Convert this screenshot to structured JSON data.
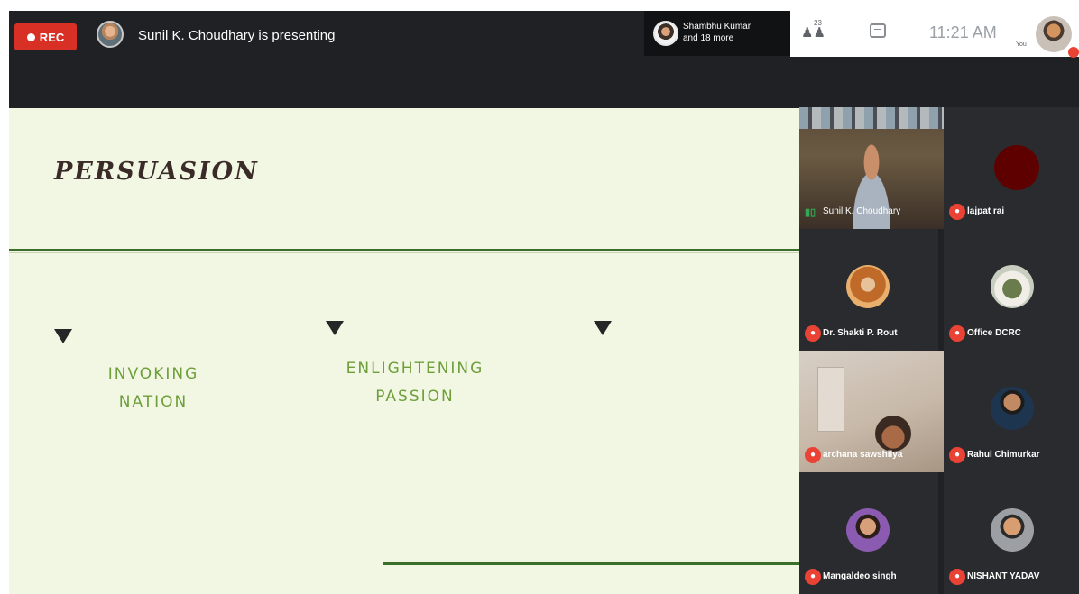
{
  "topbar": {
    "rec_label": "REC",
    "presenting_text": "Sunil K. Choudhary is presenting",
    "others": {
      "line1": "Shambhu Kumar",
      "line2": "and 18 more"
    },
    "people_count": "23",
    "clock": "11:21 AM",
    "you_label": "You"
  },
  "slide": {
    "title": "PERSUASION",
    "bullets": [
      {
        "line1": "INVOKING",
        "line2": "NATION"
      },
      {
        "line1": "ENLIGHTENING",
        "line2": "PASSION"
      },
      {
        "line1": "",
        "line2": ""
      }
    ]
  },
  "participants": [
    {
      "name": "Sunil K. Choudhary",
      "muted": false
    },
    {
      "name": "lajpat rai",
      "muted": true
    },
    {
      "name": "Dr. Shakti P. Rout",
      "muted": true
    },
    {
      "name": "Office DCRC",
      "muted": true
    },
    {
      "name": "archana sawshilya",
      "muted": true
    },
    {
      "name": "Rahul Chimurkar",
      "muted": true
    },
    {
      "name": "Mangaldeo singh",
      "muted": true
    },
    {
      "name": "NISHANT YADAV",
      "muted": true
    }
  ],
  "colors": {
    "rec": "#d93025",
    "slide_bg": "#f1f7e2",
    "slide_rule": "#3c6e2b",
    "bullet_text": "#6e9e3a",
    "meet_dark": "#202124"
  },
  "icons": [
    "record-dot-icon",
    "people-icon",
    "chat-icon",
    "mic-off-icon",
    "audio-level-icon",
    "triangle-bullet-icon"
  ]
}
